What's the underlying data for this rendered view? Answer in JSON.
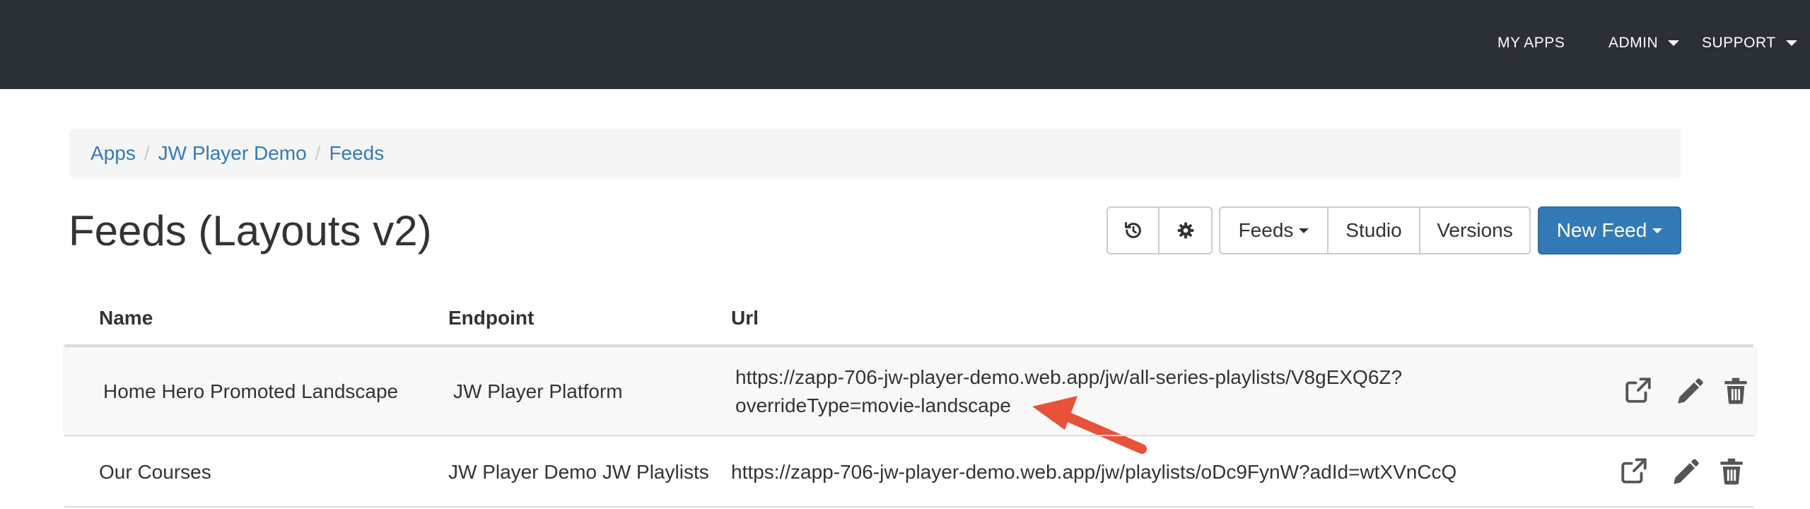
{
  "navbar": {
    "my_apps": "MY APPS",
    "admin": "ADMIN",
    "support": "SUPPORT"
  },
  "breadcrumb": {
    "items": [
      {
        "label": "Apps"
      },
      {
        "label": "JW Player Demo"
      },
      {
        "label": "Feeds"
      }
    ],
    "separator": "/"
  },
  "page": {
    "title": "Feeds (Layouts v2)"
  },
  "toolbar": {
    "history_icon": "history-icon",
    "settings_icon": "gear-icon",
    "feeds_label": "Feeds",
    "studio_label": "Studio",
    "versions_label": "Versions",
    "new_feed_label": "New Feed"
  },
  "table": {
    "headers": {
      "name": "Name",
      "endpoint": "Endpoint",
      "url": "Url"
    },
    "rows": [
      {
        "name": "Home Hero Promoted Landscape",
        "endpoint": "JW Player Platform",
        "url_line1": "https://zapp-706-jw-player-demo.web.app/jw/all-series-playlists/V8gEXQ6Z?",
        "url_line2": "overrideType=movie-landscape"
      },
      {
        "name": "Our Courses",
        "endpoint": "JW Player Demo JW Playlists",
        "url_line1": "https://zapp-706-jw-player-demo.web.app/jw/playlists/oDc9FynW?adId=wtXVnCcQ"
      }
    ],
    "row_actions": [
      "external-link-icon",
      "pencil-icon",
      "trash-icon"
    ]
  },
  "colors": {
    "navbar_bg": "#2b2f36",
    "link": "#337ab7",
    "primary": "#337ab7",
    "annotation_arrow": "#e8513a"
  }
}
